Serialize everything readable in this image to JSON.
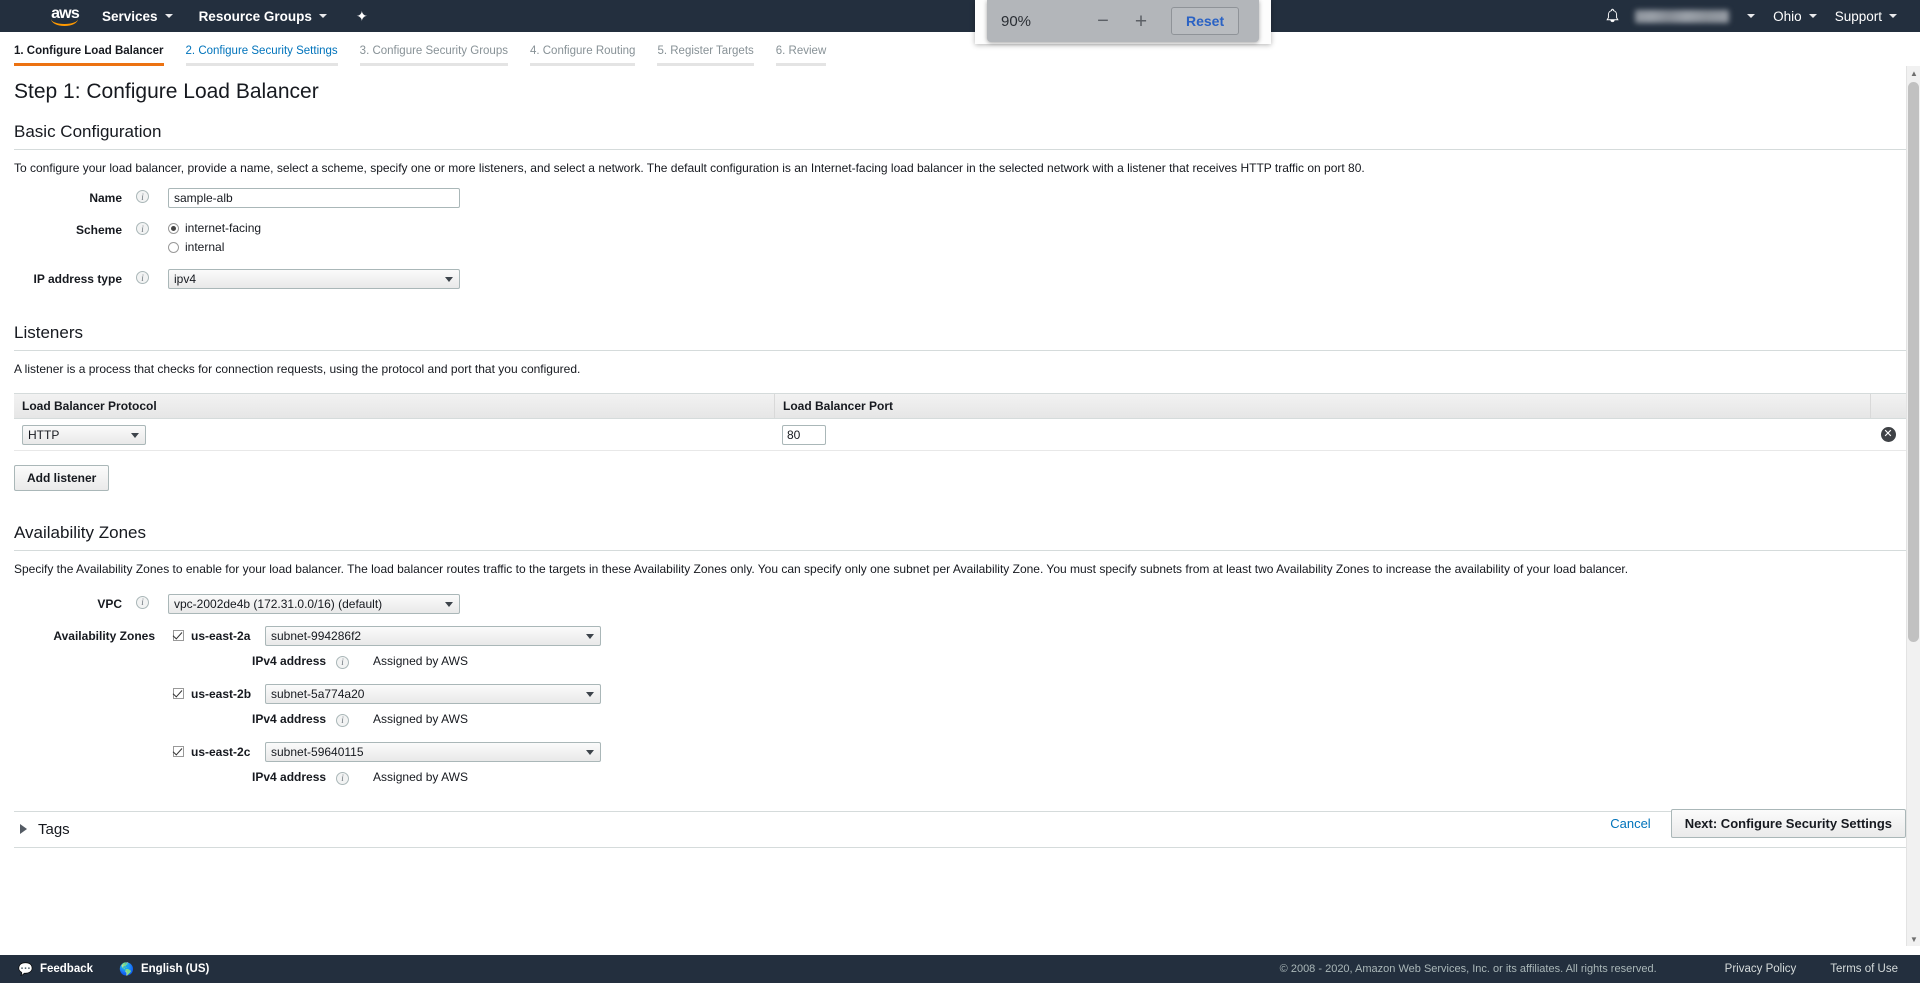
{
  "topnav": {
    "logo_alt": "aws",
    "services_label": "Services",
    "resource_groups_label": "Resource Groups",
    "pin_glyph": "✦",
    "bell_glyph": "☗",
    "account_label": "",
    "region_label": "Ohio",
    "support_label": "Support"
  },
  "zoom_popup": {
    "level": "90%",
    "minus_label": "−",
    "plus_label": "+",
    "reset_label": "Reset"
  },
  "wizard": {
    "steps": [
      {
        "label": "1. Configure Load Balancer",
        "state": "active"
      },
      {
        "label": "2. Configure Security Settings",
        "state": "link"
      },
      {
        "label": "3. Configure Security Groups",
        "state": "dim"
      },
      {
        "label": "4. Configure Routing",
        "state": "dim"
      },
      {
        "label": "5. Register Targets",
        "state": "dim"
      },
      {
        "label": "6. Review",
        "state": "dim"
      }
    ]
  },
  "page": {
    "step_title": "Step 1: Configure Load Balancer"
  },
  "basic_configuration": {
    "heading": "Basic Configuration",
    "description": "To configure your load balancer, provide a name, select a scheme, specify one or more listeners, and select a network. The default configuration is an Internet-facing load balancer in the selected network with a listener that receives HTTP traffic on port 80.",
    "name_label": "Name",
    "name_value": "sample-alb",
    "name_placeholder": "",
    "scheme_label": "Scheme",
    "scheme_options": [
      {
        "label": "internet-facing",
        "selected": true
      },
      {
        "label": "internal",
        "selected": false
      }
    ],
    "ip_type_label": "IP address type",
    "ip_type_value": "ipv4"
  },
  "listeners": {
    "heading": "Listeners",
    "description": "A listener is a process that checks for connection requests, using the protocol and port that you configured.",
    "columns": [
      "Load Balancer Protocol",
      "Load Balancer Port"
    ],
    "rows": [
      {
        "protocol": "HTTP",
        "port": "80",
        "delete_glyph": "✕"
      }
    ],
    "add_listener_label": "Add listener"
  },
  "availability_zones": {
    "heading": "Availability Zones",
    "description": "Specify the Availability Zones to enable for your load balancer. The load balancer routes traffic to the targets in these Availability Zones only. You can specify only one subnet per Availability Zone. You must specify subnets from at least two Availability Zones to increase the availability of your load balancer.",
    "vpc_label": "VPC",
    "vpc_value": "vpc-2002de4b (172.31.0.0/16) (default)",
    "az_label": "Availability Zones",
    "ipv4_label": "IPv4 address",
    "ipv4_value": "Assigned by AWS",
    "zones": [
      {
        "checked": true,
        "name": "us-east-2a",
        "subnet": "subnet-994286f2"
      },
      {
        "checked": true,
        "name": "us-east-2b",
        "subnet": "subnet-5a774a20"
      },
      {
        "checked": true,
        "name": "us-east-2c",
        "subnet": "subnet-59640115"
      }
    ]
  },
  "tags": {
    "label": "Tags",
    "expanded": false
  },
  "actions": {
    "cancel_label": "Cancel",
    "next_label": "Next: Configure Security Settings"
  },
  "footer": {
    "feedback_label": "Feedback",
    "feedback_glyph": "●",
    "language_label": "English (US)",
    "language_glyph": "●",
    "copyright": "© 2008 - 2020, Amazon Web Services, Inc. or its affiliates. All rights reserved.",
    "privacy_label": "Privacy Policy",
    "terms_label": "Terms of Use"
  },
  "colors": {
    "nav_bg": "#232f3e",
    "accent_orange": "#ec7211",
    "link_blue": "#0073bb"
  }
}
